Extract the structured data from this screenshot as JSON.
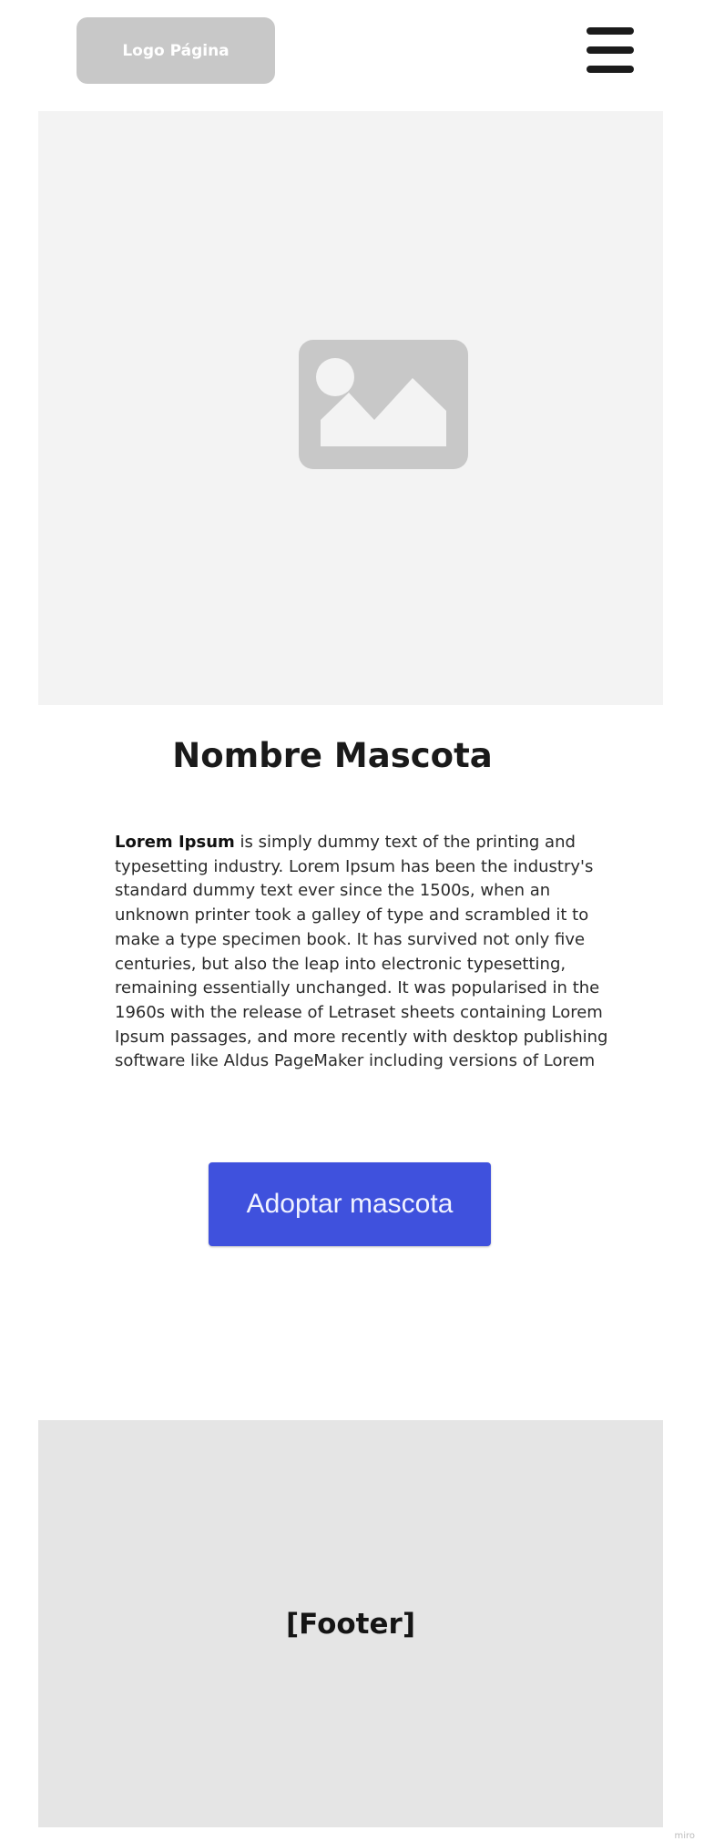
{
  "header": {
    "logo_label": "Logo Página",
    "menu_icon": "hamburger-menu-icon"
  },
  "hero": {
    "image_icon": "image-placeholder-icon"
  },
  "pet": {
    "name": "Nombre Mascota",
    "description_lead": "Lorem Ipsum",
    "description_body": " is simply dummy text of the printing and typesetting industry. Lorem Ipsum has been the industry's standard dummy text ever since the 1500s, when an unknown printer took a galley of type and scrambled it to make a type specimen book. It has survived not only five centuries, but also the leap into electronic typesetting, remaining essentially unchanged. It was popularised in the 1960s with the release of Letraset sheets containing Lorem Ipsum passages, and more recently with desktop publishing software like Aldus PageMaker including versions of Lorem"
  },
  "actions": {
    "adopt_label": "Adoptar mascota"
  },
  "footer": {
    "label": "[Footer]"
  },
  "watermark": "miro",
  "colors": {
    "accent": "#3f51dd",
    "placeholder": "#c8c8c8",
    "hero_bg": "#f3f3f3",
    "footer_bg": "#e5e5e5"
  }
}
